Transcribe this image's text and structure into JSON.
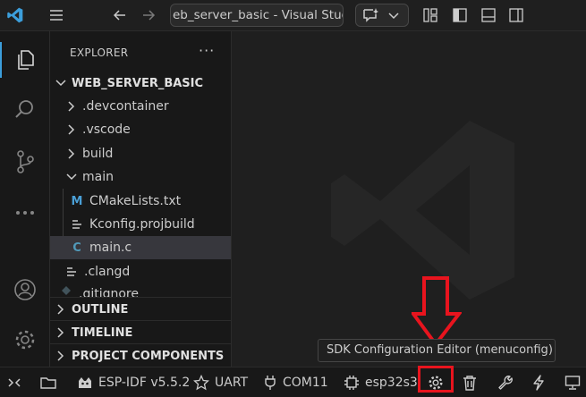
{
  "window": {
    "title": "eb_server_basic - Visual Studio",
    "app_icon": "vscode-logo-icon",
    "menu_icon": "hamburger-menu-icon",
    "nav": {
      "back_icon": "arrow-left-icon",
      "forward_icon": "arrow-right-icon"
    },
    "chat_icon": "copilot-chat-icon",
    "layout_icons": [
      "customize-layout-icon",
      "toggle-primary-sidebar-icon",
      "toggle-panel-icon",
      "toggle-secondary-sidebar-icon"
    ]
  },
  "activity_bar": {
    "items": [
      "explorer-icon",
      "search-icon",
      "source-control-icon",
      "more-icon"
    ],
    "bottom": [
      "accounts-icon",
      "manage-gear-icon"
    ]
  },
  "sidebar": {
    "header": "EXPLORER",
    "more_label": "···",
    "root": "WEB_SERVER_BASIC",
    "tree": [
      {
        "label": ".devcontainer",
        "type": "folder",
        "state": "collapsed"
      },
      {
        "label": ".vscode",
        "type": "folder",
        "state": "collapsed"
      },
      {
        "label": "build",
        "type": "folder",
        "state": "collapsed"
      },
      {
        "label": "main",
        "type": "folder",
        "state": "expanded"
      },
      {
        "label": "CMakeLists.txt",
        "type": "cmake",
        "icon_text": "M"
      },
      {
        "label": "Kconfig.projbuild",
        "type": "text"
      },
      {
        "label": "main.c",
        "type": "c",
        "icon_text": "C",
        "selected": true
      },
      {
        "label": ".clangd",
        "type": "text"
      },
      {
        "label": ".gitignore",
        "type": "text"
      }
    ],
    "sections": [
      "OUTLINE",
      "TIMELINE",
      "PROJECT COMPONENTS"
    ]
  },
  "tooltip": "SDK Configuration Editor (menuconfig)",
  "status_bar": {
    "remote_icon": "remote-indicator-icon",
    "items": [
      {
        "icon": "folder-icon",
        "label": ""
      },
      {
        "icon": "espressif-icon",
        "label": "ESP-IDF v5.5.2"
      },
      {
        "icon": "star-icon",
        "label": "UART"
      },
      {
        "icon": "plug-icon",
        "label": "COM11"
      },
      {
        "icon": "chip-icon",
        "label": "esp32s3"
      },
      {
        "icon": "gear-icon",
        "label": ""
      },
      {
        "icon": "trash-icon",
        "label": ""
      },
      {
        "icon": "wrench-icon",
        "label": ""
      },
      {
        "icon": "lightning-icon",
        "label": ""
      },
      {
        "icon": "monitor-icon",
        "label": ""
      }
    ]
  },
  "colors": {
    "accent_blue": "#3c9edb",
    "highlight_red": "#e8141e",
    "selection": "#37373d",
    "c_file": "#519aba"
  }
}
